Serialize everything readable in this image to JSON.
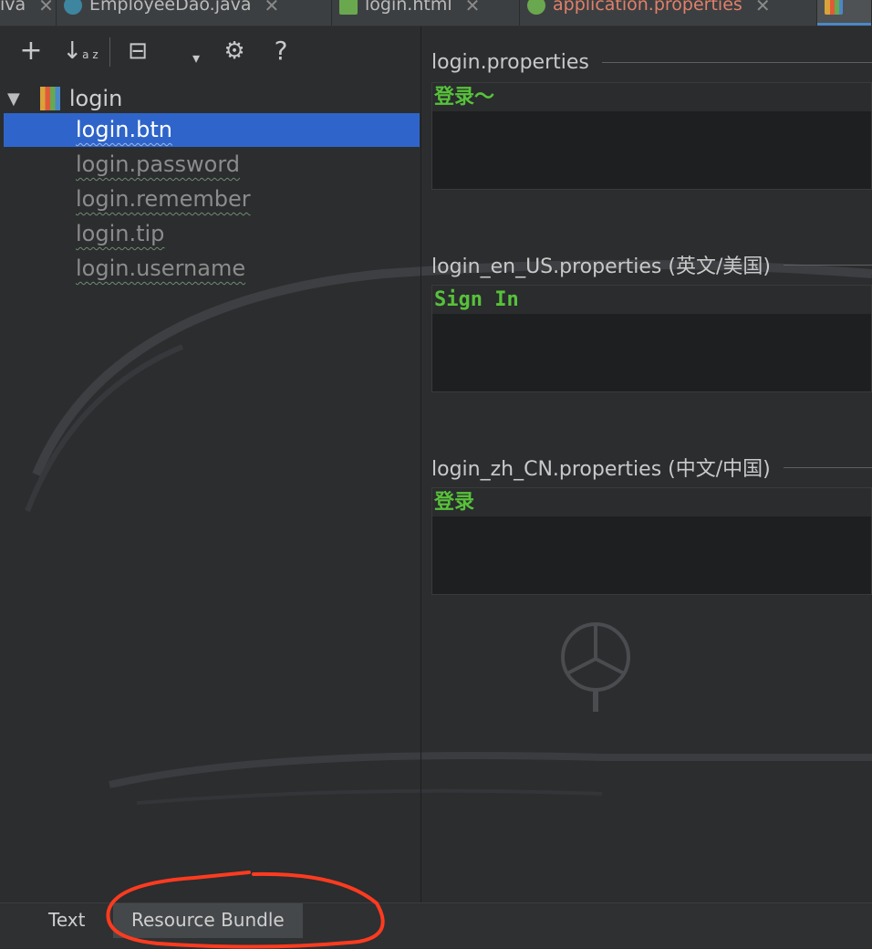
{
  "tabs": [
    {
      "label": "iva",
      "color": "#bbbbbb",
      "icon": ""
    },
    {
      "label": "EmployeeDao.java",
      "color": "#bbbbbb",
      "icon": "class-icon"
    },
    {
      "label": "login.html",
      "color": "#bbbbbb",
      "icon": "html-icon"
    },
    {
      "label": "application.properties",
      "color": "#e0806a",
      "icon": "spring-icon"
    },
    {
      "label": "",
      "color": "#bbbbbb",
      "icon": "resource-bundle-icon"
    }
  ],
  "close_glyph": "✕",
  "toolbar": {
    "add": "+",
    "sort": "↓",
    "sort_az": "a z",
    "group": "⊟",
    "dropdown": "▾",
    "settings": "⚙",
    "help": "?"
  },
  "tree": {
    "root_label": "login",
    "items": [
      "login.btn",
      "login.password",
      "login.remember",
      "login.tip",
      "login.username"
    ],
    "selected_index": 0
  },
  "sections": [
    {
      "title": "login.properties",
      "value": "登录～"
    },
    {
      "title": "login_en_US.properties (英文/美国)",
      "value": "Sign In"
    },
    {
      "title": "login_zh_CN.properties (中文/中国)",
      "value": "登录"
    }
  ],
  "bottom_tabs": {
    "text": "Text",
    "resource_bundle": "Resource Bundle"
  },
  "colors": {
    "selection": "#2f65ca",
    "value_green": "#57c23a",
    "annotation_red": "#ff3b1f"
  }
}
